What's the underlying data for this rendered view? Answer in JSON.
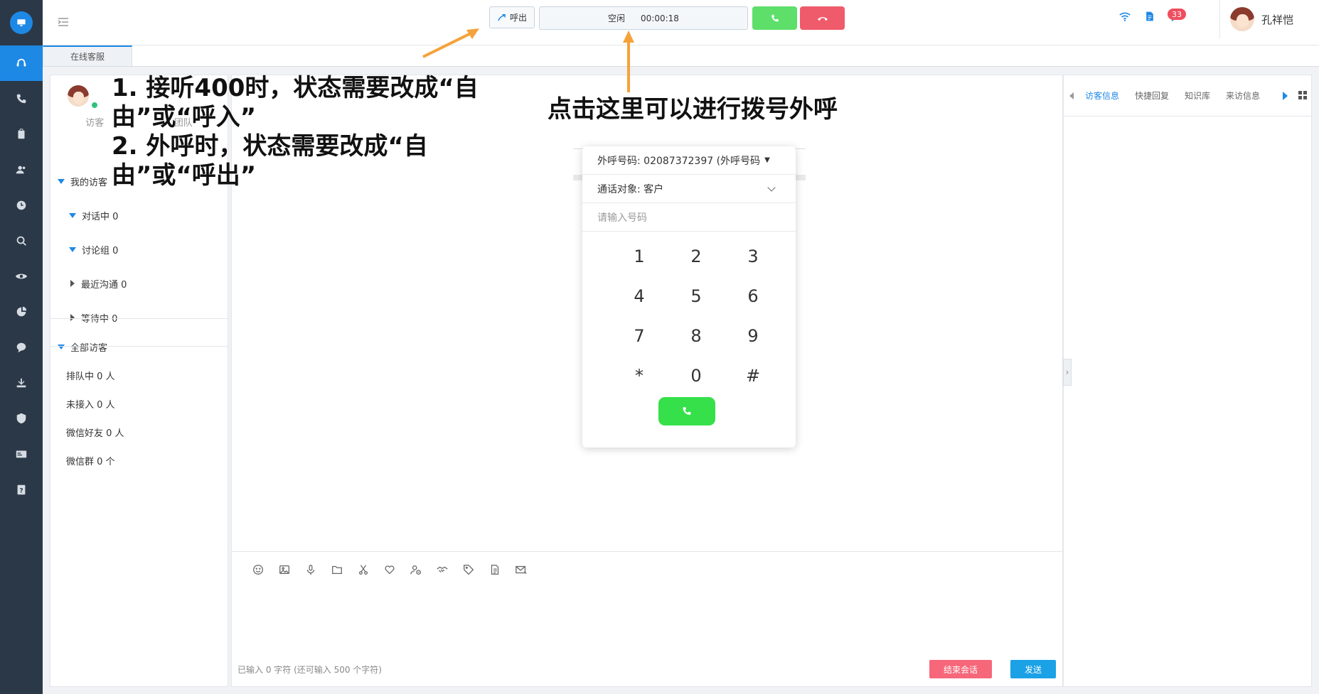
{
  "topbar": {
    "outbound_label": "呼出",
    "status_text": "空闲",
    "timer": "00:00:18",
    "notification_count": "33",
    "user_name": "孔祥恺"
  },
  "tabs": [
    "在线客服"
  ],
  "visitor_panel": {
    "tab_visitors": "访客",
    "tab_team": "团队",
    "my_visitors": "我的访客",
    "in_conversation": "对话中 0",
    "discussion_group": "讨论组 0",
    "recent_contacts": "最近沟通 0",
    "waiting": "等待中 0",
    "all_visitors": "全部访客",
    "queued": "排队中 0 人",
    "not_connected": "未接入 0 人",
    "wechat_friends": "微信好友 0 人",
    "wechat_groups": "微信群 0 个"
  },
  "dialer": {
    "outbound_number": "外呼号码: 02087372397 (外呼号码",
    "call_target": "通话对象: 客户",
    "number_placeholder": "请输入号码",
    "keys": [
      "1",
      "2",
      "3",
      "4",
      "5",
      "6",
      "7",
      "8",
      "9",
      "*",
      "0",
      "#"
    ]
  },
  "chat": {
    "char_count": "已输入 0 字符  (还可输入 500 个字符)",
    "end_label": "结束会话",
    "send_label": "发送"
  },
  "right_panel": {
    "tabs": [
      "访客信息",
      "快捷回复",
      "知识库",
      "来访信息"
    ]
  },
  "annotations": {
    "left_1": "1. 接听400时，状态需要改成“自由”或“呼入”",
    "left_2": "2. 外呼时，状态需要改成“自由”或“呼出”",
    "right": "点击这里可以进行拨号外呼"
  },
  "colors": {
    "accent": "#1e88e5",
    "answer": "#5ddf6a",
    "hangup": "#ef5b6b",
    "annotation_arrow": "#f5a23a",
    "sidebar": "#2b3847"
  }
}
